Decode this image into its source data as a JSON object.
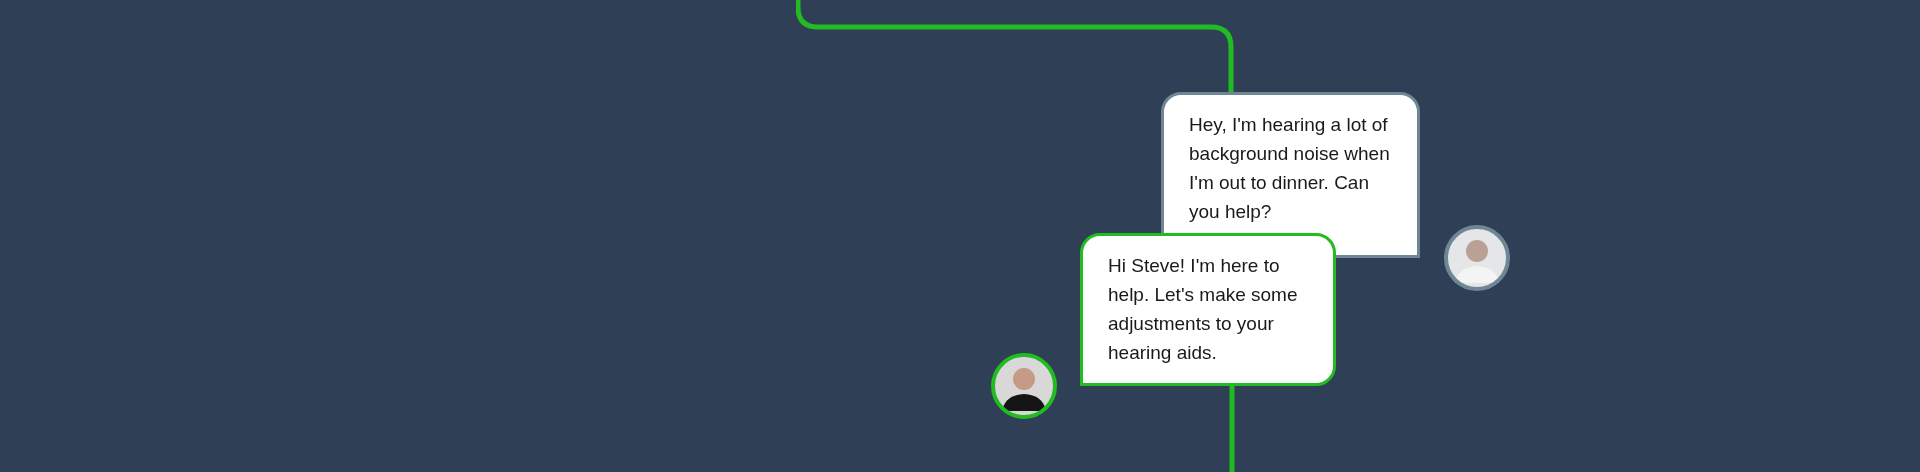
{
  "messages": [
    {
      "kind": "received",
      "text": "Hey, I'm hearing a lot of background noise when I'm out to dinner. Can you help?",
      "color": "#6f8794"
    },
    {
      "kind": "sent",
      "text": "Hi Steve! I'm here to help. Let's make some adjustments to your hearing aids.",
      "color": "#22bb22"
    }
  ]
}
